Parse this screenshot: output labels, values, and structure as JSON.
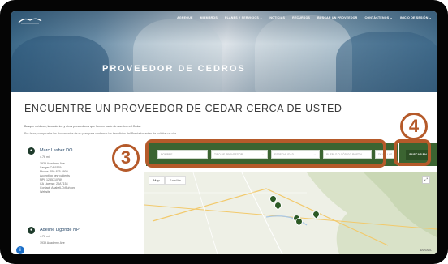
{
  "nav": {
    "items": [
      "AGREGUE",
      "MIEMBROS",
      "PLANES Y SERVICIOS ⌄",
      "NOTICIAS",
      "RECURSOS",
      "BUSCAR UN PROVEEDOR",
      "CONTÁCTENOS ⌄",
      "INICIO DE SESIÓN ⌄"
    ]
  },
  "hero": {
    "title": "PROVEEDOR DE CEDROS"
  },
  "main": {
    "heading": "ENCUENTRE UN PROVEEDOR DE CEDAR CERCA DE USTED",
    "intro": "Busque médicos, laboratorios y otros proveedores que formen parte de nuestra red Cedar.",
    "note": "Por favor, compruebe los documentos de su plan para confirmar los beneficios del Prestador antes de solicitar un cita."
  },
  "providers": [
    {
      "name": "Marc Lasher DO",
      "distance": "4.76 mi",
      "lines": [
        "1939 Academy Ave",
        "Sanger CA 93654",
        "Phone: 559-875-6900",
        "Accepting new patients",
        "NPI: 1285710789",
        "CA License: 20A7154",
        "Contact: AcabelLO@uh.org",
        "Website"
      ]
    },
    {
      "name": "Adeline Ligonde NP",
      "distance": "4.76 mi",
      "lines": [
        "1939 Academy Ave"
      ]
    }
  ],
  "search": {
    "fields": [
      {
        "placeholder": "NOMBRE",
        "dropdown": false
      },
      {
        "placeholder": "TIPO DE PROVEEDOR",
        "dropdown": true
      },
      {
        "placeholder": "ESPECIALIDAD",
        "dropdown": true
      },
      {
        "placeholder": "PUEBLO O CÓDIGO POSTAL",
        "dropdown": false
      },
      {
        "placeholder": "DE MILLAS",
        "dropdown": true
      }
    ],
    "button_label": "BUSCAR EN"
  },
  "annotations": {
    "step3": "3",
    "step4": "4",
    "color": "#b55a2a"
  },
  "map": {
    "tabs": [
      "Map",
      "Satellite"
    ],
    "attribution": "ESPAÑOL"
  },
  "colors": {
    "green": "#3b6431",
    "button": "#2d4f25",
    "annotation": "#b55a2a"
  }
}
